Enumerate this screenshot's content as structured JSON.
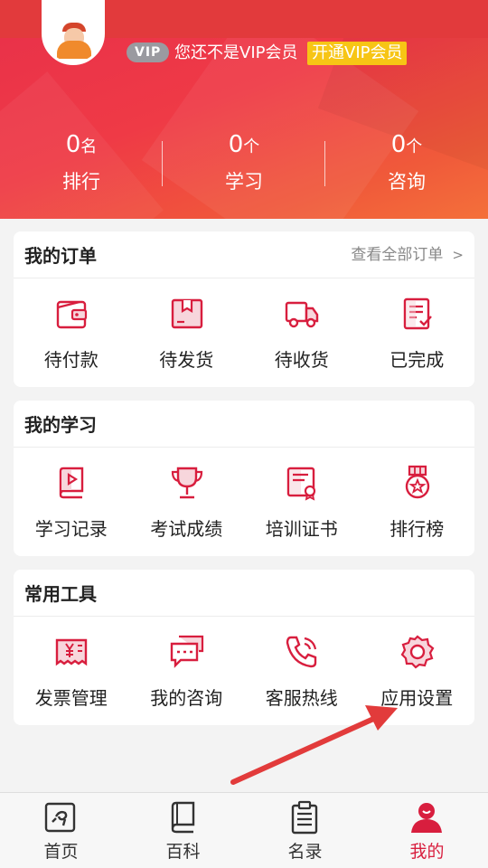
{
  "header": {
    "vip_tag": "VIP",
    "vip_status": "您还不是VIP会员",
    "vip_open": "开通VIP会员"
  },
  "stats": [
    {
      "num": "0",
      "unit": "名",
      "label": "排行"
    },
    {
      "num": "0",
      "unit": "个",
      "label": "学习"
    },
    {
      "num": "0",
      "unit": "个",
      "label": "咨询"
    }
  ],
  "orders": {
    "title": "我的订单",
    "more": "查看全部订单",
    "more_arrow": ">",
    "items": [
      {
        "label": "待付款",
        "icon": "wallet-icon"
      },
      {
        "label": "待发货",
        "icon": "package-icon"
      },
      {
        "label": "待收货",
        "icon": "truck-icon"
      },
      {
        "label": "已完成",
        "icon": "checklist-icon"
      }
    ]
  },
  "study": {
    "title": "我的学习",
    "items": [
      {
        "label": "学习记录",
        "icon": "video-book-icon"
      },
      {
        "label": "考试成绩",
        "icon": "trophy-icon"
      },
      {
        "label": "培训证书",
        "icon": "certificate-icon"
      },
      {
        "label": "排行榜",
        "icon": "medal-icon"
      }
    ]
  },
  "tools": {
    "title": "常用工具",
    "items": [
      {
        "label": "发票管理",
        "icon": "invoice-icon"
      },
      {
        "label": "我的咨询",
        "icon": "chat-icon"
      },
      {
        "label": "客服热线",
        "icon": "phone-icon"
      },
      {
        "label": "应用设置",
        "icon": "settings-icon"
      }
    ]
  },
  "tabbar": [
    {
      "label": "首页",
      "icon": "home-icon",
      "active": false
    },
    {
      "label": "百科",
      "icon": "book-icon",
      "active": false
    },
    {
      "label": "名录",
      "icon": "clipboard-icon",
      "active": false
    },
    {
      "label": "我的",
      "icon": "user-icon",
      "active": true
    }
  ],
  "colors": {
    "accent": "#d81e3e",
    "vip_yellow": "#f7c515",
    "hero_red": "#e8304a"
  }
}
